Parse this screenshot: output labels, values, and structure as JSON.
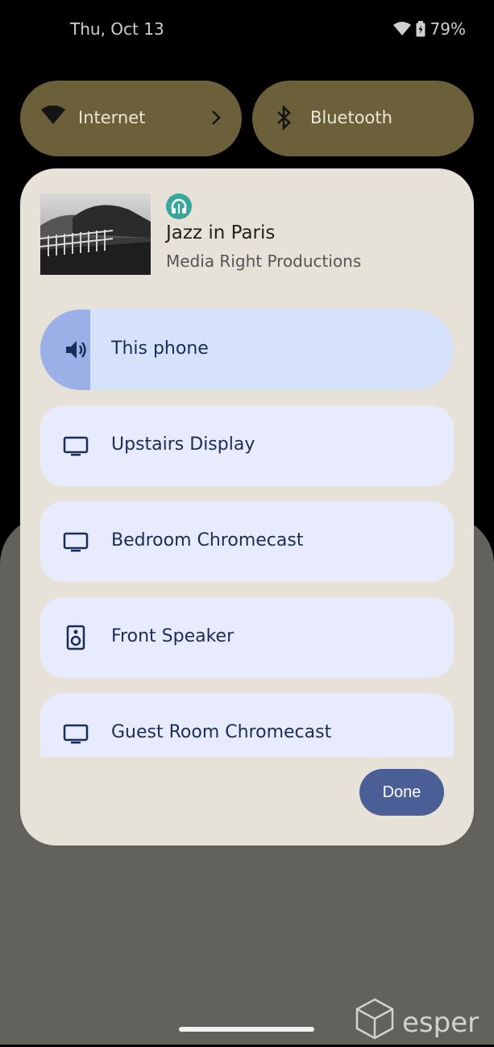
{
  "status_bar": {
    "date": "Thu, Oct 13",
    "battery": "79%"
  },
  "quick_tiles": [
    {
      "label": "Internet",
      "icon": "wifi-icon"
    },
    {
      "label": "Bluetooth",
      "icon": "bluetooth-icon"
    }
  ],
  "media": {
    "title": "Jazz in Paris",
    "artist": "Media Right Productions",
    "app_icon": "headphones-icon"
  },
  "devices": [
    {
      "label": "This phone",
      "icon": "speaker-volume-icon",
      "selected": true,
      "volume": 0.12
    },
    {
      "label": "Upstairs Display",
      "icon": "tv-icon"
    },
    {
      "label": "Bedroom Chromecast",
      "icon": "tv-icon"
    },
    {
      "label": "Front Speaker",
      "icon": "speaker-icon"
    },
    {
      "label": "Guest Room Chromecast",
      "icon": "tv-icon"
    }
  ],
  "done_label": "Done",
  "watermark": "esper",
  "colors": {
    "accent": "#4b5f97",
    "tile": "#6b603a",
    "dialog": "#e7e2d8",
    "selected": "#d6e1fc"
  }
}
